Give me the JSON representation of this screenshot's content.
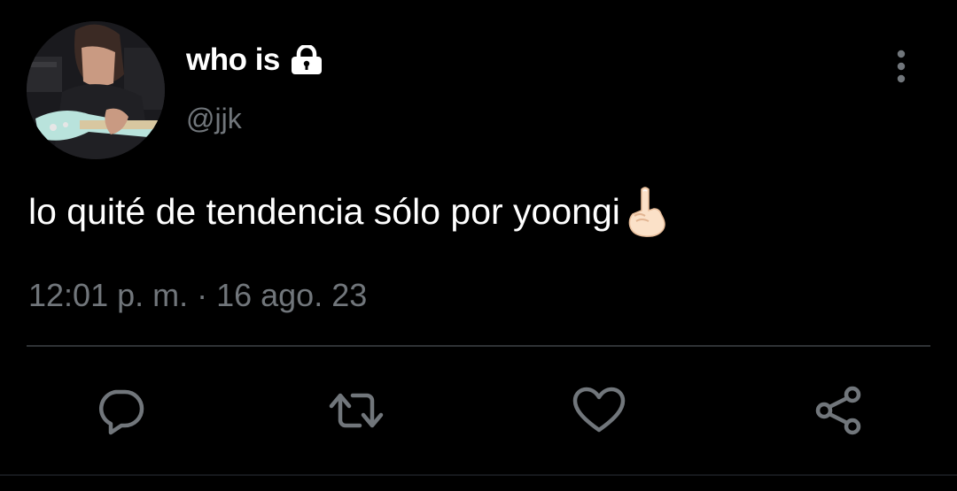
{
  "user": {
    "display_name": "who is",
    "handle": "@jjk",
    "avatar_icon": "avatar-photo",
    "protected_icon": "lock-icon"
  },
  "tweet": {
    "text": "lo quité de tendencia sólo por yoongi",
    "emoji": "pointing-up-emoji",
    "timestamp": "12:01 p. m. · 16 ago. 23"
  },
  "actions": [
    {
      "icon": "reply-icon"
    },
    {
      "icon": "retweet-icon"
    },
    {
      "icon": "like-icon"
    },
    {
      "icon": "share-icon"
    }
  ],
  "menu": {
    "icon": "more-options-icon"
  },
  "colors": {
    "background": "#000000",
    "text": "#ffffff",
    "secondary_text": "#71767b",
    "divider": "#2f3336"
  }
}
